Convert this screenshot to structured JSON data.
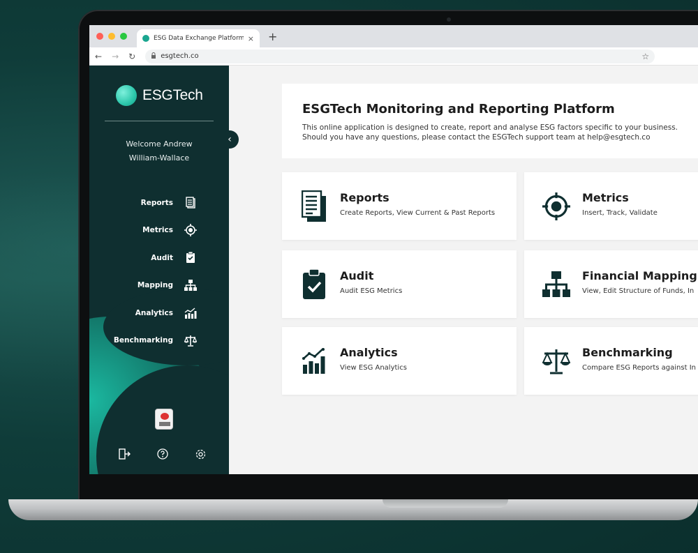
{
  "browser": {
    "tab_title": "ESG Data Exchange Platform |",
    "tab_close": "×",
    "new_tab": "+",
    "url": "esgtech.co"
  },
  "app": {
    "logo_text": "ESGTech",
    "welcome_line1": "Welcome Andrew",
    "welcome_line2": "William-Wallace",
    "sidebar": {
      "items": [
        {
          "label": "Reports",
          "icon": "reports-icon"
        },
        {
          "label": "Metrics",
          "icon": "target-icon"
        },
        {
          "label": "Audit",
          "icon": "clipboard-icon"
        },
        {
          "label": "Mapping",
          "icon": "hierarchy-icon"
        },
        {
          "label": "Analytics",
          "icon": "chart-icon"
        },
        {
          "label": "Benchmarking",
          "icon": "scale-icon"
        }
      ],
      "footer_icons": [
        "logout-icon",
        "help-icon",
        "settings-icon"
      ]
    },
    "hero": {
      "title": "ESGTech Monitoring and Reporting Platform",
      "line1": "This online application is designed to create, report and analyse ESG factors specific to your business.",
      "line2": "Should you have any questions, please contact the ESGTech support team at help@esgtech.co"
    },
    "cards": [
      {
        "title": "Reports",
        "subtitle": "Create Reports, View Current & Past Reports",
        "icon": "reports-icon"
      },
      {
        "title": "Metrics",
        "subtitle": "Insert, Track, Validate",
        "icon": "target-icon"
      },
      {
        "title": "Audit",
        "subtitle": "Audit ESG Metrics",
        "icon": "clipboard-check-icon"
      },
      {
        "title": "Financial Mapping",
        "subtitle": "View, Edit Structure of Funds, In",
        "icon": "hierarchy-icon"
      },
      {
        "title": "Analytics",
        "subtitle": "View ESG Analytics",
        "icon": "chart-icon"
      },
      {
        "title": "Benchmarking",
        "subtitle": "Compare ESG Reports against In",
        "icon": "scale-icon"
      }
    ]
  },
  "colors": {
    "sidebar": "#0f2f30",
    "accent": "#1bb8a0",
    "icon_dark": "#0f2f30"
  }
}
